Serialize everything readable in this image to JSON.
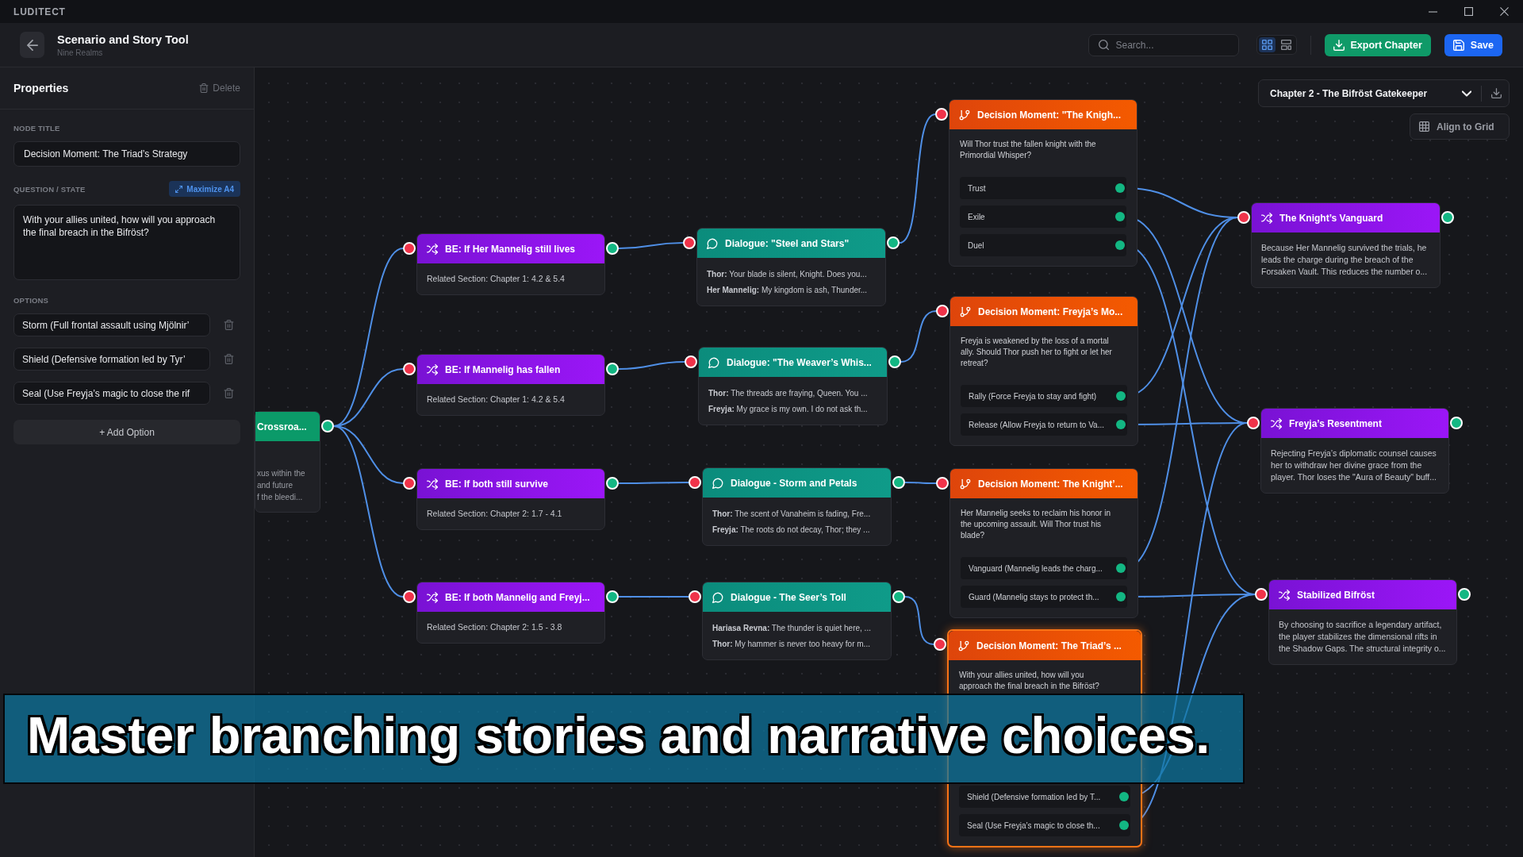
{
  "window": {
    "title": "LUDITECT"
  },
  "header": {
    "title": "Scenario and Story Tool",
    "subtitle": "Nine Realms",
    "search": {
      "placeholder": "Search..."
    },
    "view_modes": [
      {
        "kind": "grid",
        "selected": true
      },
      {
        "kind": "board",
        "selected": false
      }
    ],
    "actions": [
      {
        "kind": "export",
        "label": "Export Chapter"
      },
      {
        "kind": "save",
        "label": "Save"
      }
    ]
  },
  "properties": {
    "title": "Properties",
    "delete_label": "Delete",
    "node_title": {
      "label": "NODE TITLE",
      "value": "Decision Moment: The Triad’s Strategy"
    },
    "question": {
      "label": "QUESTION / STATE",
      "action": "Maximize A4",
      "value": "With your allies united, how will you approach the final breach in the Bifröst?"
    },
    "options": {
      "label": "OPTIONS",
      "items": [
        {
          "value": "Storm (Full frontal assault using Mjölnir’"
        },
        {
          "value": "Shield (Defensive formation led by Tyr’"
        },
        {
          "value": "Seal (Use Freyja’s magic to close the rif"
        }
      ],
      "add_label": "+ Add Option"
    }
  },
  "canvas": {
    "chapter": "Chapter 2 - The Bifröst Gatekeeper",
    "align_label": "Align to Grid",
    "nodes": [
      {
        "kind": "hub",
        "title": "Crossroa...",
        "lines": [
          "xus within the",
          "and future",
          "f the bleedi..."
        ],
        "selected": false
      },
      {
        "kind": "branch",
        "title": "BE: If Her Mannelig still lives",
        "text": "Related Section: Chapter 1: 4.2 & 5.4",
        "selected": false
      },
      {
        "kind": "branch",
        "title": "BE: If Mannelig has fallen",
        "text": "Related Section: Chapter 1: 4.2 & 5.4",
        "selected": false
      },
      {
        "kind": "branch",
        "title": "BE: If both still survive",
        "text": "Related Section: Chapter 2: 1.7 - 4.1",
        "selected": false
      },
      {
        "kind": "branch",
        "title": "BE: If both Mannelig and Freyj...",
        "text": "Related Section: Chapter 2: 1.5 - 3.8",
        "selected": false
      },
      {
        "kind": "dialogue",
        "title": "Dialogue: \"Steel and Stars\"",
        "lines": [
          "**Thor:** Your blade is silent, Knight. Does you...",
          "**Her Mannelig:** My kingdom is ash, Thunder..."
        ],
        "selected": false
      },
      {
        "kind": "dialogue",
        "title": "Dialogue: \"The Weaver’s Whis...",
        "lines": [
          "**Thor:** The threads are fraying, Queen. You ...",
          "**Freyja:** My grace is my own. I do not ask th..."
        ],
        "selected": false
      },
      {
        "kind": "dialogue",
        "title": "Dialogue - Storm and Petals",
        "lines": [
          "**Thor:** The scent of Vanaheim is fading, Fre...",
          "**Freyja:** The roots do not decay, Thor; they ..."
        ],
        "selected": false
      },
      {
        "kind": "dialogue",
        "title": "Dialogue - The Seer’s Toll",
        "lines": [
          "**Hariasa Revna:** The thunder is quiet here, ...",
          "**Thor:** My hammer is never too heavy for m..."
        ],
        "selected": false
      },
      {
        "kind": "decision",
        "title": "Decision Moment: \"The Knigh...",
        "text": "Will Thor trust the fallen knight with the Primordial Whisper?",
        "options": [
          {
            "label": "Trust"
          },
          {
            "label": "Exile"
          },
          {
            "label": "Duel"
          }
        ],
        "selected": false
      },
      {
        "kind": "decision",
        "title": "Decision Moment: Freyja’s Mo...",
        "text": "Freyja is weakened by the loss of a mortal ally. Should Thor push her to fight or let her retreat?",
        "options": [
          {
            "label": "Rally (Force Freyja to stay and fight)"
          },
          {
            "label": "Release (Allow Freyja to return to Va..."
          }
        ],
        "selected": false
      },
      {
        "kind": "decision",
        "title": "Decision Moment: The Knight’...",
        "text": "Her Mannelig seeks to reclaim his honor in the upcoming assault. Will Thor trust his blade?",
        "options": [
          {
            "label": "Vanguard (Mannelig leads the charg..."
          },
          {
            "label": "Guard (Mannelig stays to protect th..."
          }
        ],
        "selected": false
      },
      {
        "kind": "decision",
        "title": "Decision Moment: The Triad’s ...",
        "text": "With your allies united, how will you approach the final breach in the Bifröst?",
        "options": [
          {
            "label": "Shield (Defensive formation led by T..."
          },
          {
            "label": "Seal (Use Freyja’s magic to close th..."
          }
        ],
        "selected": true
      },
      {
        "kind": "branch",
        "title": "The Knight’s Vanguard",
        "text": "Because Her Mannelig survived the trials, he leads the charge during the breach of the Forsaken Vault. This reduces the number o...",
        "selected": false
      },
      {
        "kind": "branch",
        "title": "Freyja’s Resentment",
        "text": "Rejecting Freyja’s diplomatic counsel causes her to withdraw her divine grace from the player. Thor loses the \"Aura of Beauty\" buff...",
        "selected": false
      },
      {
        "kind": "branch",
        "title": "Stabilized Bifröst",
        "text": "By choosing to sacrifice a legendary artifact, the player stabilizes the dimensional rifts in the Shadow Gaps. The structural integrity o...",
        "selected": false
      }
    ]
  },
  "caption": "Master branching stories and narrative choices."
}
